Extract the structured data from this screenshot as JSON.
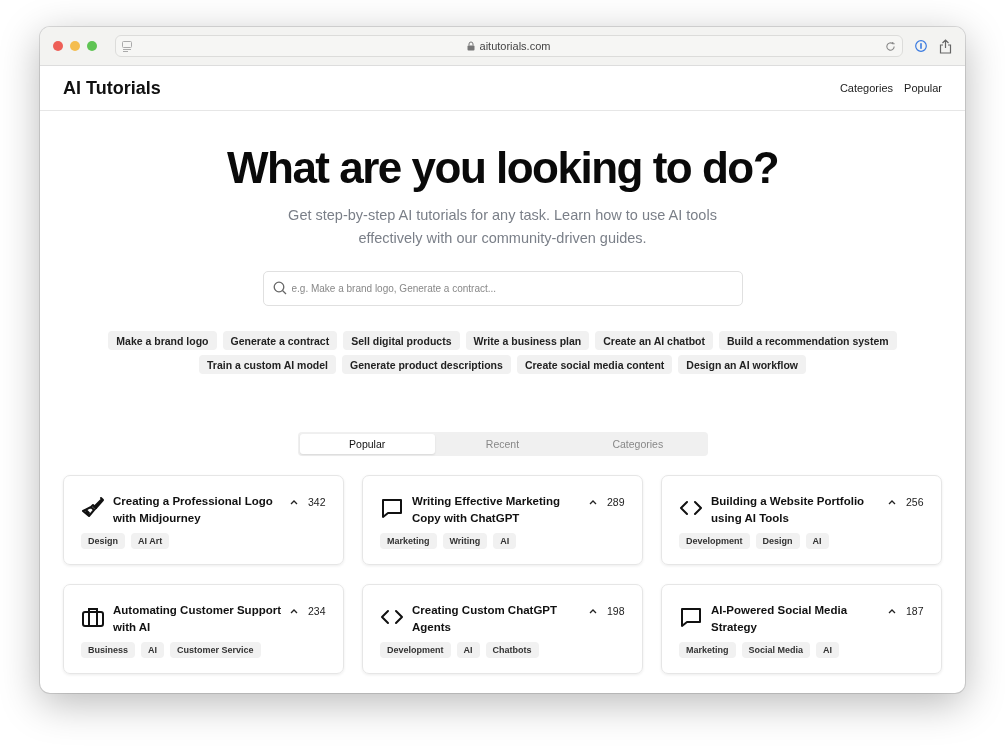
{
  "browser": {
    "url": "aitutorials.com"
  },
  "header": {
    "logo": "AI Tutorials",
    "nav": [
      "Categories",
      "Popular"
    ]
  },
  "hero": {
    "title": "What are you looking to do?",
    "subtitle": "Get step-by-step AI tutorials for any task. Learn how to use AI tools effectively with our community-driven guides."
  },
  "search": {
    "placeholder": "e.g. Make a brand logo, Generate a contract..."
  },
  "suggestions": [
    [
      "Make a brand logo",
      "Generate a contract",
      "Sell digital products",
      "Write a business plan",
      "Create an AI chatbot",
      "Build a recommendation system"
    ],
    [
      "Train a custom AI model",
      "Generate product descriptions",
      "Create social media content",
      "Design an AI workflow"
    ]
  ],
  "tabs": [
    {
      "label": "Popular",
      "selected": true
    },
    {
      "label": "Recent",
      "selected": false
    },
    {
      "label": "Categories",
      "selected": false
    }
  ],
  "tutorials": [
    {
      "kind": "brush",
      "title": "Creating a Professional Logo with Midjourney",
      "votes": "342",
      "tags": [
        "Design",
        "AI Art"
      ]
    },
    {
      "kind": "chat",
      "title": "Writing Effective Marketing Copy with ChatGPT",
      "votes": "289",
      "tags": [
        "Marketing",
        "Writing",
        "AI"
      ]
    },
    {
      "kind": "code",
      "title": "Building a Website Portfolio using AI Tools",
      "votes": "256",
      "tags": [
        "Development",
        "Design",
        "AI"
      ]
    },
    {
      "kind": "briefcase",
      "title": "Automating Customer Support with AI",
      "votes": "234",
      "tags": [
        "Business",
        "AI",
        "Customer Service"
      ]
    },
    {
      "kind": "code",
      "title": "Creating Custom ChatGPT Agents",
      "votes": "198",
      "tags": [
        "Development",
        "AI",
        "Chatbots"
      ]
    },
    {
      "kind": "chat",
      "title": "AI-Powered Social Media Strategy",
      "votes": "187",
      "tags": [
        "Marketing",
        "Social Media",
        "AI"
      ]
    }
  ]
}
